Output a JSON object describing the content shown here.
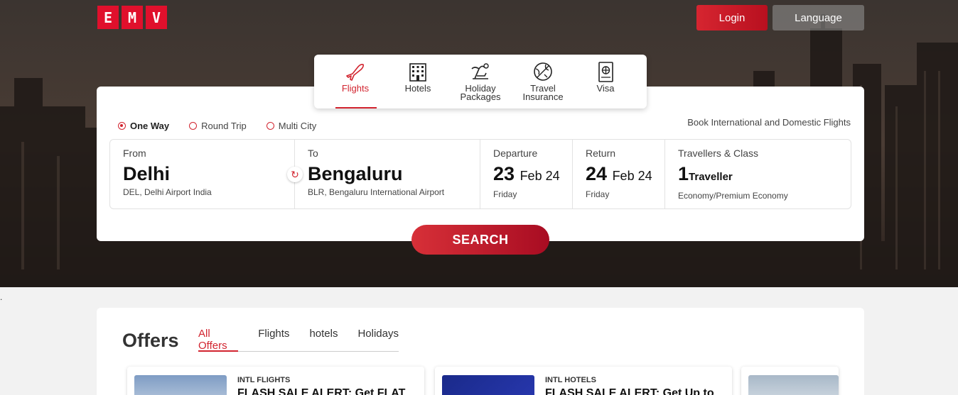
{
  "brand": {
    "letters": [
      "E",
      "M",
      "V"
    ]
  },
  "header": {
    "login_label": "Login",
    "language_label": "Language"
  },
  "service_tabs": [
    {
      "label": "Flights",
      "icon": "plane-icon",
      "active": true
    },
    {
      "label": "Hotels",
      "icon": "hotel-icon",
      "active": false
    },
    {
      "label": "Holiday Packages",
      "icon": "holiday-icon",
      "active": false
    },
    {
      "label": "Travel Insurance",
      "icon": "insurance-icon",
      "active": false
    },
    {
      "label": "Visa",
      "icon": "passport-icon",
      "active": false
    }
  ],
  "trip_types": [
    {
      "label": "One Way",
      "selected": true
    },
    {
      "label": "Round Trip",
      "selected": false
    },
    {
      "label": "Multi City",
      "selected": false
    }
  ],
  "book_text": "Book International and Domestic Flights",
  "search": {
    "from": {
      "caption": "From",
      "city": "Delhi",
      "detail": "DEL, Delhi Airport India"
    },
    "to": {
      "caption": "To",
      "city": "Bengaluru",
      "detail": "BLR, Bengaluru International Airport"
    },
    "departure": {
      "caption": "Departure",
      "day": "23",
      "month_year": "Feb 24",
      "weekday": "Friday"
    },
    "return": {
      "caption": "Return",
      "day": "24",
      "month_year": "Feb 24",
      "weekday": "Friday"
    },
    "travellers": {
      "caption": "Travellers & Class",
      "count": "1",
      "unit": "Traveller",
      "class": "Economy/Premium Economy"
    },
    "button_label": "SEARCH"
  },
  "stray_text": ".",
  "offers": {
    "title": "Offers",
    "tabs": [
      {
        "label": "All Offers",
        "active": true
      },
      {
        "label": "Flights",
        "active": false
      },
      {
        "label": "hotels",
        "active": false
      },
      {
        "label": "Holidays",
        "active": false
      }
    ],
    "cards": [
      {
        "category": "INTL FLIGHTS",
        "headline": "FLASH SALE ALERT: Get FLAT"
      },
      {
        "category": "INTL HOTELS",
        "headline": "FLASH SALE ALERT: Get Up to"
      },
      {
        "category": "",
        "headline": ""
      }
    ]
  },
  "colors": {
    "accent": "#d2242f",
    "brand": "#e0102c"
  }
}
